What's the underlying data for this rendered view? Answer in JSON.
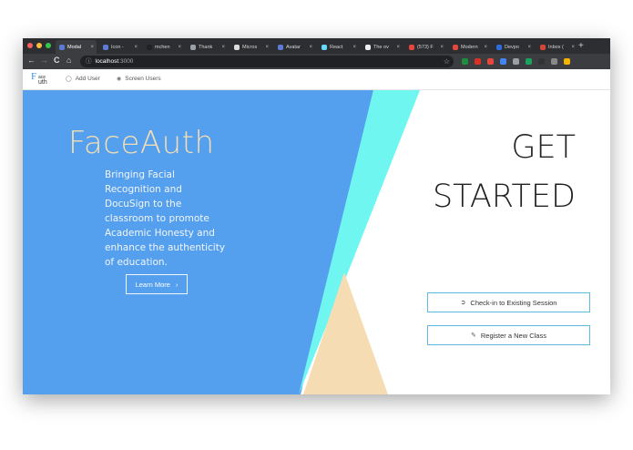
{
  "browser": {
    "tabs": [
      {
        "title": "Modal",
        "color": "#5b7bd5"
      },
      {
        "title": "Icon - ",
        "color": "#5b7bd5"
      },
      {
        "title": "mchen",
        "color": "#222222"
      },
      {
        "title": "Thank ",
        "color": "#9aa0a6"
      },
      {
        "title": "Micros",
        "color": "#dddddd"
      },
      {
        "title": "Avatar",
        "color": "#5b7bd5"
      },
      {
        "title": "React ",
        "color": "#61dafb"
      },
      {
        "title": "The ov",
        "color": "#eeeeee"
      },
      {
        "title": "(573) F",
        "color": "#e8453c"
      },
      {
        "title": "Modern",
        "color": "#e8453c"
      },
      {
        "title": "Devpo",
        "color": "#2d6cdf"
      },
      {
        "title": "Inbox (",
        "color": "#d44638"
      }
    ],
    "tab_close": "×",
    "new_tab": "+",
    "url_host": "localhost",
    "url_port": ":3000",
    "nav": {
      "back": "←",
      "forward": "→",
      "reload": "C",
      "home": "⌂"
    },
    "bookmark": "☆",
    "extension_colors": [
      "#1e8e3e",
      "#d93025",
      "#e8453c",
      "#4285f4",
      "#9aa0a6",
      "#1aa260",
      "#333333",
      "#888888",
      "#f4b400"
    ]
  },
  "appnav": {
    "logo_f": "F",
    "logo_ace": "ace",
    "logo_uth": "uth",
    "add_user": "Add User",
    "screen_users": "Screen Users"
  },
  "hero": {
    "brand": "FaceAuth",
    "tagline": "Bringing Facial Recognition and DocuSign to the classroom to promote Academic Honesty and enhance the authenticity of education.",
    "learn_more": "Learn More",
    "learn_more_arrow": "›",
    "get_line1": "GET",
    "get_line2": "STARTED",
    "checkin": "Check-in to Existing Session",
    "register": "Register a New Class"
  },
  "colors": {
    "blue": "#55a0ee",
    "cyan": "#6ff6f0",
    "sand": "#f6dcb2",
    "button_border": "#5fb8e0"
  }
}
